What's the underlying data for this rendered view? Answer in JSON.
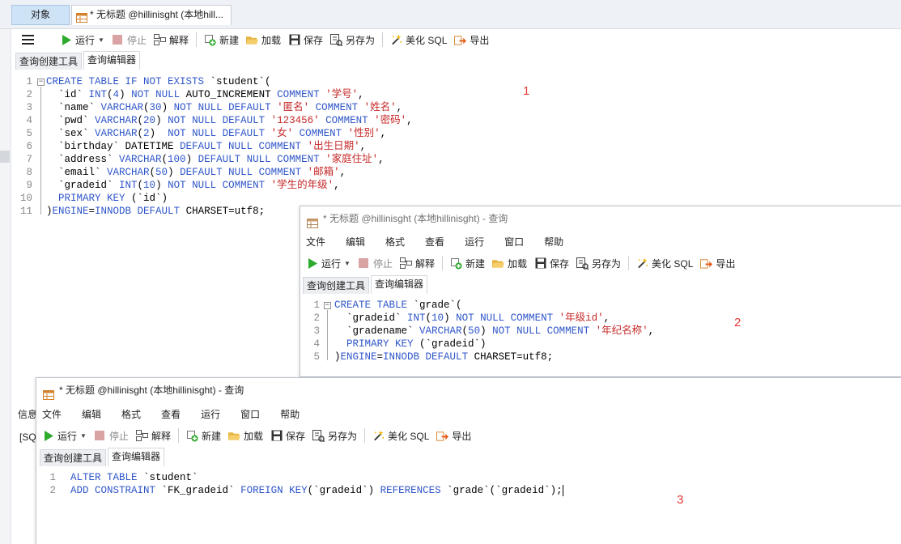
{
  "main": {
    "tab_objects": "对象",
    "tab_query": "* 无标题 @hillinisght (本地hill...",
    "toolbar": {
      "run": "运行",
      "stop": "停止",
      "explain": "解释",
      "new": "新建",
      "load": "加载",
      "save": "保存",
      "save_as": "另存为",
      "beautify": "美化 SQL",
      "export": "导出"
    },
    "subtabs": [
      "查询创建工具",
      "查询编辑器"
    ],
    "lines": [
      "1",
      "2",
      "3",
      "4",
      "5",
      "6",
      "7",
      "8",
      "9",
      "10",
      "11"
    ],
    "marker": "1",
    "info_tab": "信息",
    "info_text": "[SQ"
  },
  "window2": {
    "title": "* 无标题 @hillinisght (本地hillinisght) - 查询",
    "menu": [
      "文件",
      "编辑",
      "格式",
      "查看",
      "运行",
      "窗口",
      "帮助"
    ],
    "lines": [
      "1",
      "2",
      "3",
      "4",
      "5"
    ],
    "marker": "2"
  },
  "window3": {
    "title": "* 无标题 @hillinisght (本地hillinisght) - 查询",
    "menu": [
      "文件",
      "编辑",
      "格式",
      "查看",
      "运行",
      "窗口",
      "帮助"
    ],
    "lines": [
      "1",
      "2"
    ],
    "marker": "3"
  },
  "code1": [
    [
      [
        "kw",
        "CREATE TABLE IF NOT EXISTS "
      ],
      [
        "tx",
        "`student`("
      ]
    ],
    [
      [
        "tx",
        "  `id` "
      ],
      [
        "kw",
        "INT"
      ],
      [
        "tx",
        "("
      ],
      [
        "nm",
        "4"
      ],
      [
        "tx",
        ") "
      ],
      [
        "kw",
        "NOT NULL "
      ],
      [
        "tx",
        "AUTO_INCREMENT "
      ],
      [
        "kw",
        "COMMENT "
      ],
      [
        "str",
        "'学号'"
      ],
      [
        "tx",
        ","
      ]
    ],
    [
      [
        "tx",
        "  `name` "
      ],
      [
        "kw",
        "VARCHAR"
      ],
      [
        "tx",
        "("
      ],
      [
        "nm",
        "30"
      ],
      [
        "tx",
        ") "
      ],
      [
        "kw",
        "NOT NULL DEFAULT "
      ],
      [
        "str",
        "'匿名' "
      ],
      [
        "kw",
        "COMMENT "
      ],
      [
        "str",
        "'姓名'"
      ],
      [
        "tx",
        ","
      ]
    ],
    [
      [
        "tx",
        "  `pwd` "
      ],
      [
        "kw",
        "VARCHAR"
      ],
      [
        "tx",
        "("
      ],
      [
        "nm",
        "20"
      ],
      [
        "tx",
        ") "
      ],
      [
        "kw",
        "NOT NULL DEFAULT "
      ],
      [
        "str",
        "'123456' "
      ],
      [
        "kw",
        "COMMENT "
      ],
      [
        "str",
        "'密码'"
      ],
      [
        "tx",
        ","
      ]
    ],
    [
      [
        "tx",
        "  `sex` "
      ],
      [
        "kw",
        "VARCHAR"
      ],
      [
        "tx",
        "("
      ],
      [
        "nm",
        "2"
      ],
      [
        "tx",
        ")  "
      ],
      [
        "kw",
        "NOT NULL DEFAULT "
      ],
      [
        "str",
        "'女' "
      ],
      [
        "kw",
        "COMMENT "
      ],
      [
        "str",
        "'性别'"
      ],
      [
        "tx",
        ","
      ]
    ],
    [
      [
        "tx",
        "  `birthday` DATETIME "
      ],
      [
        "kw",
        "DEFAULT NULL COMMENT "
      ],
      [
        "str",
        "'出生日期'"
      ],
      [
        "tx",
        ","
      ]
    ],
    [
      [
        "tx",
        "  `address` "
      ],
      [
        "kw",
        "VARCHAR"
      ],
      [
        "tx",
        "("
      ],
      [
        "nm",
        "100"
      ],
      [
        "tx",
        ") "
      ],
      [
        "kw",
        "DEFAULT NULL COMMENT "
      ],
      [
        "str",
        "'家庭住址'"
      ],
      [
        "tx",
        ","
      ]
    ],
    [
      [
        "tx",
        "  `email` "
      ],
      [
        "kw",
        "VARCHAR"
      ],
      [
        "tx",
        "("
      ],
      [
        "nm",
        "50"
      ],
      [
        "tx",
        ") "
      ],
      [
        "kw",
        "DEFAULT NULL COMMENT "
      ],
      [
        "str",
        "'邮箱'"
      ],
      [
        "tx",
        ","
      ]
    ],
    [
      [
        "tx",
        "  `gradeid` "
      ],
      [
        "kw",
        "INT"
      ],
      [
        "tx",
        "("
      ],
      [
        "nm",
        "10"
      ],
      [
        "tx",
        ") "
      ],
      [
        "kw",
        "NOT NULL COMMENT "
      ],
      [
        "str",
        "'学生的年级'"
      ],
      [
        "tx",
        ","
      ]
    ],
    [
      [
        "kw",
        "  PRIMARY KEY "
      ],
      [
        "tx",
        "(`id`)"
      ]
    ],
    [
      [
        "tx",
        ")"
      ],
      [
        "kw",
        "ENGINE"
      ],
      [
        "tx",
        "="
      ],
      [
        "kw",
        "INNODB DEFAULT "
      ],
      [
        "tx",
        "CHARSET=utf8;"
      ]
    ]
  ],
  "code2": [
    [
      [
        "kw",
        "CREATE TABLE "
      ],
      [
        "tx",
        "`grade`("
      ]
    ],
    [
      [
        "tx",
        "  `gradeid` "
      ],
      [
        "kw",
        "INT"
      ],
      [
        "tx",
        "("
      ],
      [
        "nm",
        "10"
      ],
      [
        "tx",
        ") "
      ],
      [
        "kw",
        "NOT NULL COMMENT "
      ],
      [
        "str",
        "'年级id'"
      ],
      [
        "tx",
        ","
      ]
    ],
    [
      [
        "tx",
        "  `gradename` "
      ],
      [
        "kw",
        "VARCHAR"
      ],
      [
        "tx",
        "("
      ],
      [
        "nm",
        "50"
      ],
      [
        "tx",
        ") "
      ],
      [
        "kw",
        "NOT NULL COMMENT "
      ],
      [
        "str",
        "'年纪名称'"
      ],
      [
        "tx",
        ","
      ]
    ],
    [
      [
        "kw",
        "  PRIMARY KEY "
      ],
      [
        "tx",
        "(`gradeid`)"
      ]
    ],
    [
      [
        "tx",
        ")"
      ],
      [
        "kw",
        "ENGINE"
      ],
      [
        "tx",
        "="
      ],
      [
        "kw",
        "INNODB DEFAULT "
      ],
      [
        "tx",
        "CHARSET=utf8;"
      ]
    ]
  ],
  "code3": [
    [
      [
        "kw",
        "ALTER TABLE "
      ],
      [
        "tx",
        "`student`"
      ]
    ],
    [
      [
        "kw",
        "ADD CONSTRAINT "
      ],
      [
        "tx",
        "`FK_gradeid` "
      ],
      [
        "kw",
        "FOREIGN KEY"
      ],
      [
        "tx",
        "(`gradeid`) "
      ],
      [
        "kw",
        "REFERENCES "
      ],
      [
        "tx",
        "`grade`(`gradeid`);"
      ]
    ]
  ],
  "colors": {
    "keyword": "#2f56c9",
    "string": "#c62828",
    "marker": "#e53935",
    "run_green": "#2eaa2e"
  },
  "icons": [
    "hamburger-menu-icon",
    "run-icon",
    "stop-icon",
    "explain-icon",
    "new-icon",
    "load-folder-icon",
    "save-icon",
    "save-as-icon",
    "beautify-wand-icon",
    "export-icon",
    "query-tab-icon"
  ]
}
